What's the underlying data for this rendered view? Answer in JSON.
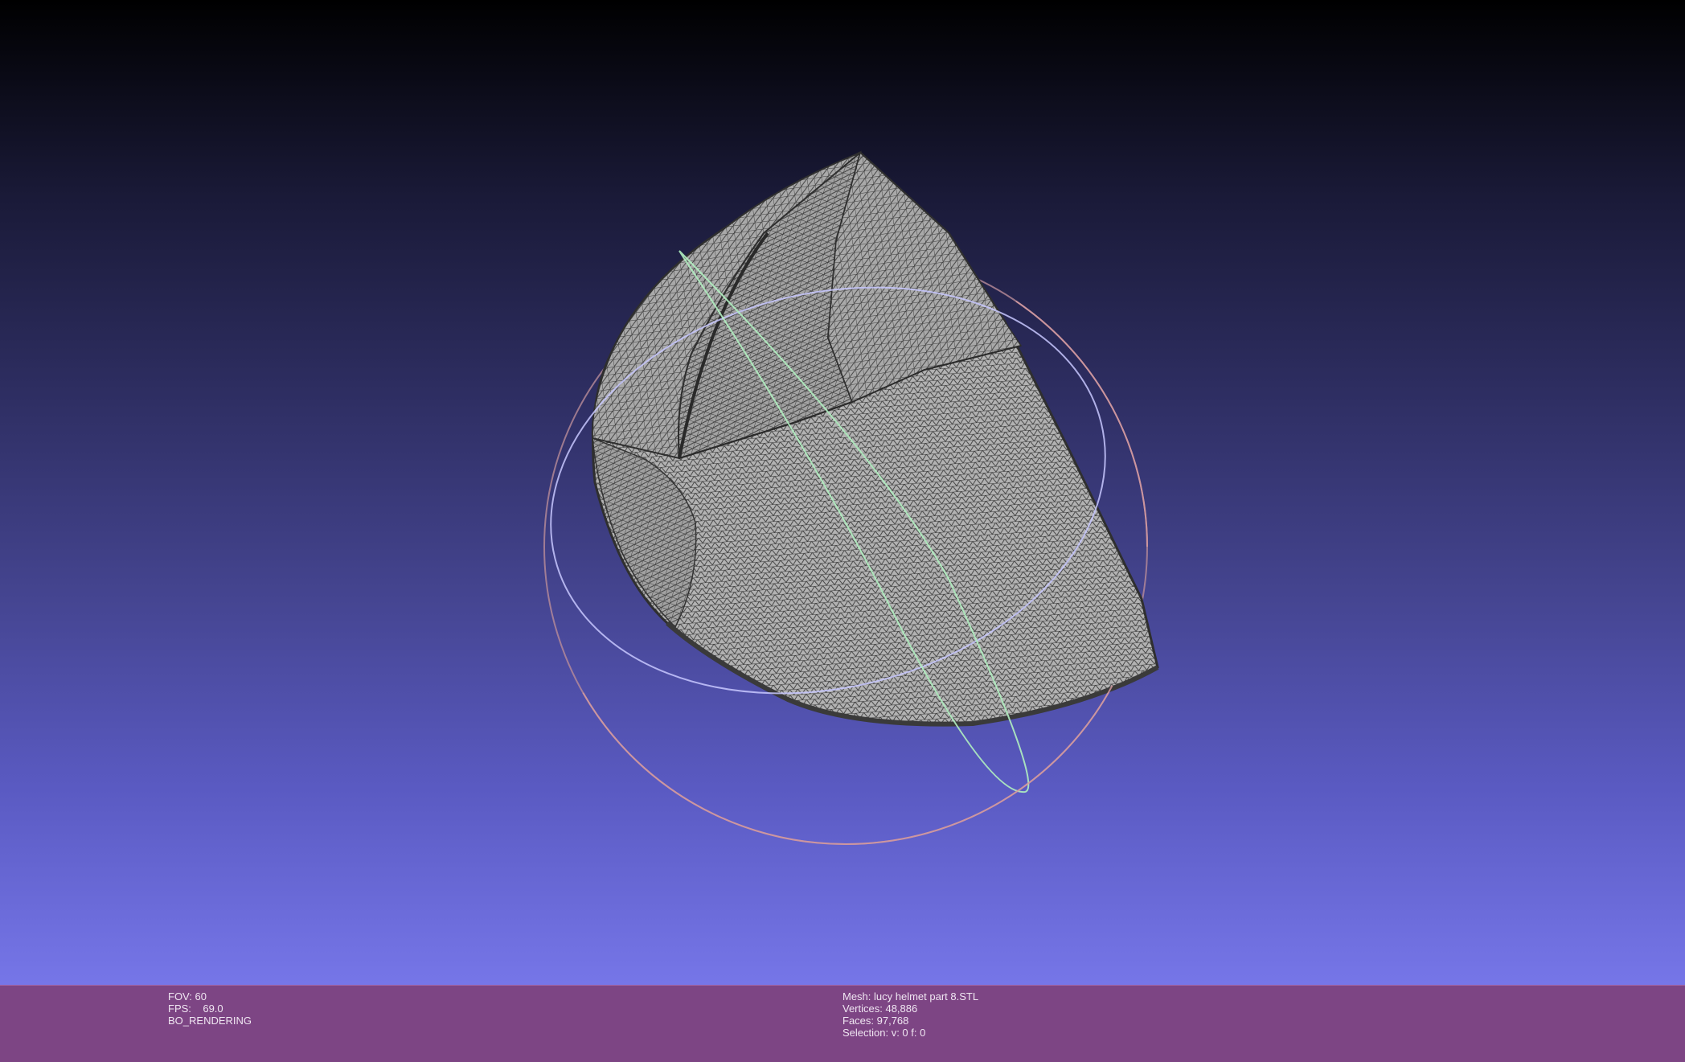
{
  "viewer": {
    "background_top": "#000000",
    "background_bottom": "#7676e8",
    "mesh_color": "#9a9a9a",
    "trackball_colors": {
      "x_ring": "#b0f0c0",
      "y_ring": "#c8c8ff",
      "z_ring": "#e0a0a0"
    }
  },
  "status_left": {
    "fov": "FOV: 60",
    "fps": "FPS:    69.0",
    "mode": "BO_RENDERING"
  },
  "status_right": {
    "mesh": "Mesh: lucy helmet part 8.STL",
    "vertices": "Vertices: 48,886",
    "faces": "Faces: 97,768",
    "selection": "Selection: v: 0 f: 0"
  },
  "info_bar_color": "#7d4584"
}
